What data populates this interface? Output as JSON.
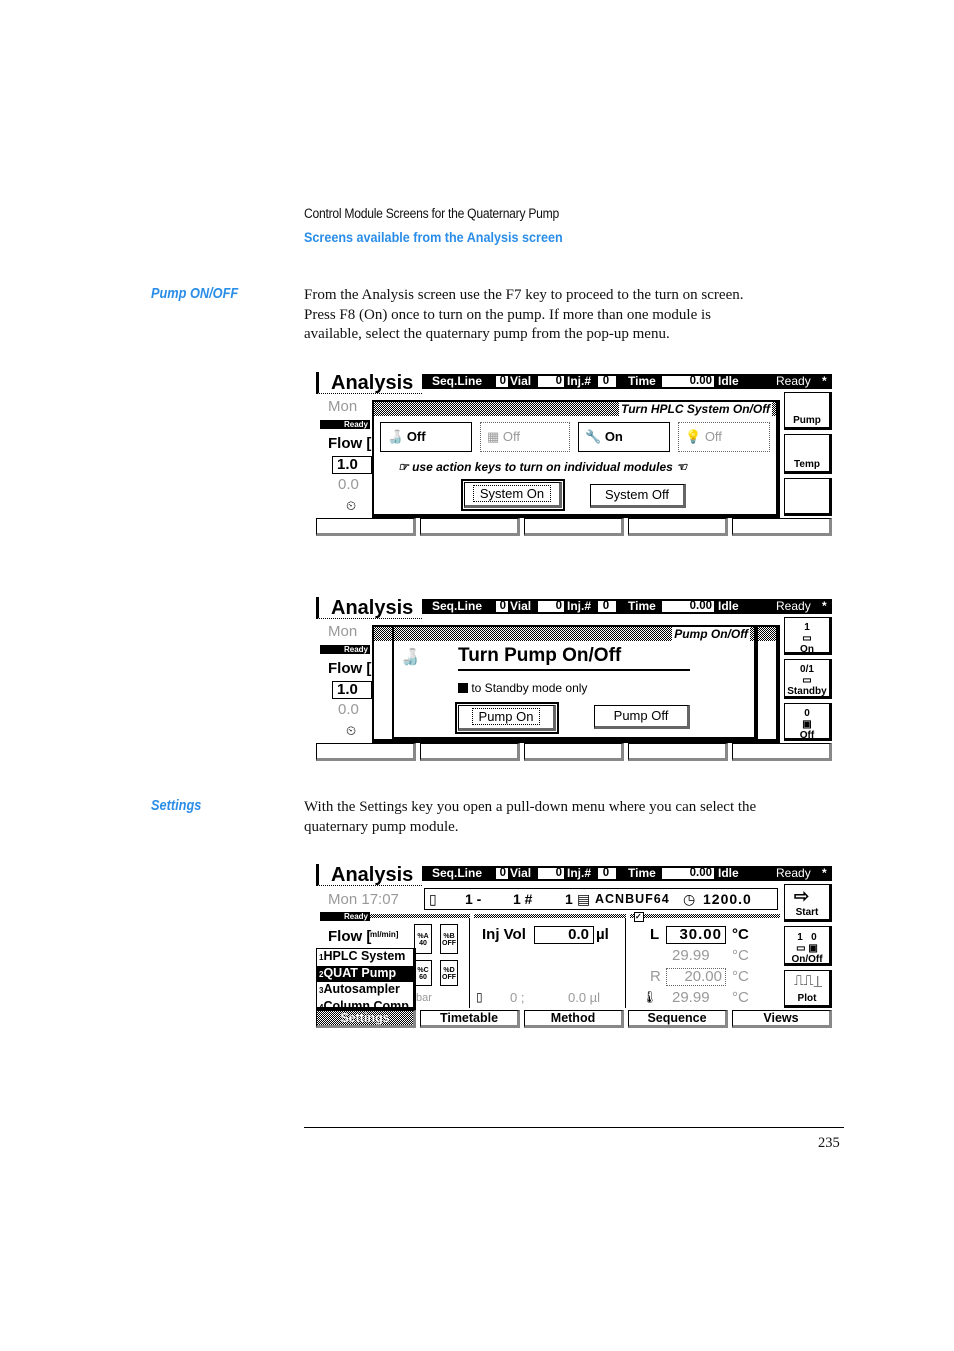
{
  "header": {
    "chapter": "Control Module Screens for the Quaternary Pump",
    "section": "Screens available from the Analysis screen"
  },
  "pump_onoff": {
    "heading": "Pump ON/OFF",
    "text_lines": [
      "From the Analysis screen use the F7 key to proceed to the turn on screen.",
      "Press F8 (On) once to turn on the pump. If more than one module is",
      "available, select the quaternary pump from the pop-up menu."
    ]
  },
  "settings": {
    "heading": "Settings",
    "text_lines": [
      "With the Settings key you open a pull-down menu where you can select the",
      "quaternary pump module."
    ]
  },
  "statusbar": {
    "title": "Analysis",
    "seq_label": "Seq.Line",
    "seq": "0",
    "vial_label": "Vial",
    "vial": "0",
    "inj_label": "Inj.#",
    "inj": "0",
    "time_label": "Time",
    "time": "0.00",
    "state": "Idle",
    "ready": "Ready",
    "star": "*"
  },
  "left": {
    "mon": "Mon",
    "ready_badge": "Ready",
    "flow": "Flow [",
    "flow_value": "1.0",
    "flow_actual": "0.0"
  },
  "screen1": {
    "dialog_title": "Turn HPLC System On/Off",
    "modules": [
      {
        "state": "Off",
        "active": true,
        "icon": "pump-bottles-icon"
      },
      {
        "state": "Off",
        "active": false,
        "icon": "autosampler-icon"
      },
      {
        "state": "On",
        "active": true,
        "icon": "column-wrench-icon"
      },
      {
        "state": "Off",
        "active": false,
        "icon": "lamp-icon"
      }
    ],
    "hint": "use action keys to turn on individual modules",
    "system_on": "System On",
    "system_off": "System Off",
    "right_keys": [
      "Pump",
      "Temp",
      ""
    ]
  },
  "screen2": {
    "dialog_title": "Pump On/Off",
    "heading": "Turn Pump On/Off",
    "checkbox_label": "to Standby mode only",
    "checkbox_checked": true,
    "pump_on": "Pump On",
    "pump_off": "Pump Off",
    "right_keys": [
      {
        "top": "1",
        "label": "On"
      },
      {
        "top": "0/1",
        "label": "Standby"
      },
      {
        "top": "0",
        "label": "Off"
      }
    ]
  },
  "screen3": {
    "mon": "Mon 17:07",
    "seq": "1 -",
    "vial": "1 #",
    "inj": "1",
    "solvent": "ACNBUF64",
    "pressure": "1200.0",
    "flow_label": "Flow [",
    "flow_unit": "ml/min]",
    "bottles": [
      "%A 40",
      "%B OFF",
      "%C 60",
      "%D OFF"
    ],
    "inj_vol_label": "Inj Vol",
    "inj_vol": "0.0",
    "inj_unit": "µl",
    "inj_actual": "0 ;",
    "inj_actual_vol": "0.0 µl",
    "temp_left_label": "L",
    "temp_left": "30.00",
    "temp_unit": "°C",
    "temp_left_actual": "29.99",
    "temp_right_label": "R",
    "temp_right": "20.00",
    "temp_right_actual": "29.99",
    "pressure_label": "bar",
    "menu": [
      {
        "n": "1",
        "label": "HPLC System"
      },
      {
        "n": "2",
        "label": "QUAT Pump",
        "selected": true
      },
      {
        "n": "3",
        "label": "Autosampler"
      },
      {
        "n": "4",
        "label": "Column Comp"
      }
    ],
    "softkeys": [
      "Settings",
      "Timetable",
      "Method",
      "Sequence",
      "Views"
    ],
    "right_keys": [
      "Start",
      "On/Off",
      "Plot"
    ],
    "onoff_top": "1   0"
  },
  "page_number": "235"
}
